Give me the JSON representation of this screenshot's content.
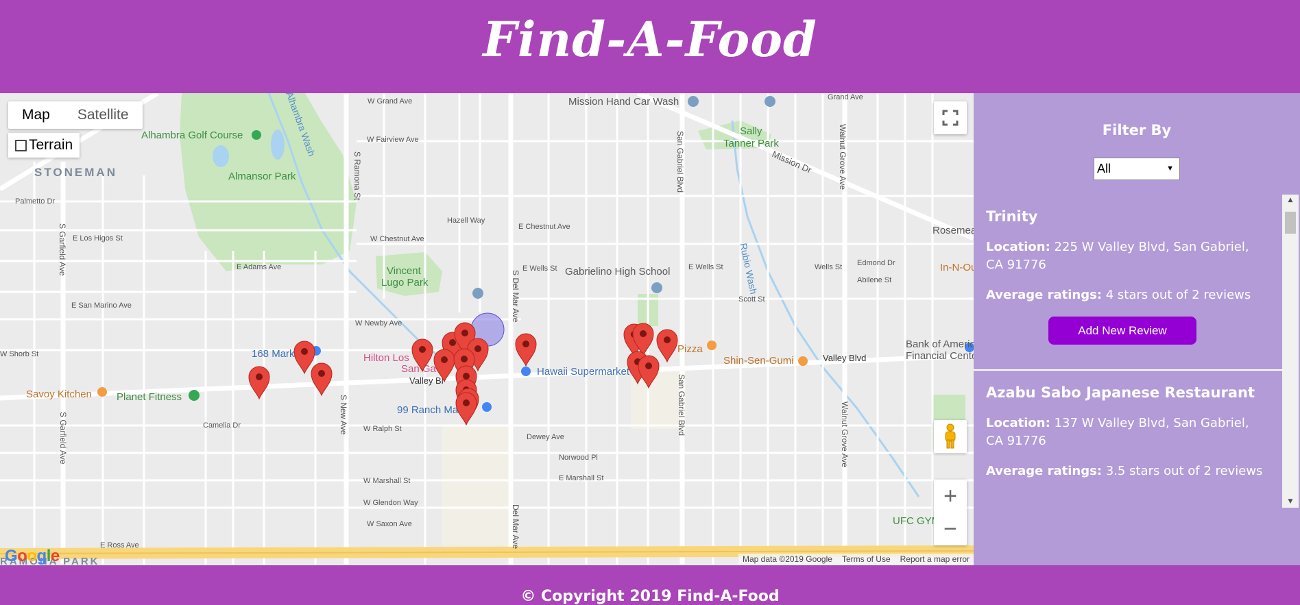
{
  "header": {
    "title": "Find-A-Food"
  },
  "map": {
    "controls": {
      "map_label": "Map",
      "satellite_label": "Satellite",
      "terrain_label": "Terrain",
      "zoom_in": "+",
      "zoom_out": "−"
    },
    "logo": "Google",
    "attribution": {
      "data": "Map data ©2019 Google",
      "terms": "Terms of Use",
      "report": "Report a map error"
    },
    "places": {
      "alhambra_golf": "Alhambra Golf Course",
      "stoneman": "STONEMAN",
      "almansor_park": "Almansor Park",
      "vincent_lugo": "Vincent",
      "vincent_lugo2": "Lugo Park",
      "gabrielino": "Gabrielino High School",
      "sally_tanner": "Sally",
      "sally_tanner2": "Tanner Park",
      "mission_hand": "Mission Hand Car Wash",
      "hawaii": "Hawaii Supermarket",
      "ranch99": "99 Ranch Ma",
      "planet_fitness": "Planet Fitness",
      "savoy": "Savoy Kitchen",
      "shin_sen": "Shin-Sen-Gumi",
      "boa": "Bank of America",
      "boa2": "Financial Center",
      "hilton": "Hilton Los",
      "san_ga": "San Ga",
      "pizza": "Pizza",
      "in_n_out": "In-N-Ou",
      "rosemead": "Rosemea",
      "ufc": "UFC GYM",
      "ramona_park": "RAMONA PARK",
      "market168": "168 Mark",
      "rubio_wash": "Rubio Wash",
      "alhambra_wash": "Alhambra Wash"
    },
    "streets": {
      "ramona": "S Ramona St",
      "delmar": "S Del Mar Ave",
      "delmar2": "Del Mar Ave",
      "sangabriel": "San Gabriel Blvd",
      "sangabriel2": "San Gabriel Blvd",
      "walnut_grove": "Walnut Grove Ave",
      "walnut_grove2": "Walnut Grove Ave",
      "garfield": "S Garfield Ave",
      "garfield2": "S Garfield Ave",
      "new_ave": "S New Ave",
      "valley": "Valley Blvd",
      "valley2": "Valley Bl",
      "mission": "Mission Dr",
      "grand": "W Grand Ave",
      "grand2": "Grand Ave",
      "fairview": "W Fairview Ave",
      "chestnut": "E Chestnut Ave",
      "chestnut_w": "W Chestnut Ave",
      "wells": "E Wells St",
      "wells2": "E Wells St",
      "wells3": "Wells St",
      "adams": "E Adams Ave",
      "newby": "W Newby Ave",
      "shorb": "W Shorb St",
      "camelia": "Camelia Dr",
      "ralph": "W Ralph St",
      "dewey": "Dewey Ave",
      "norwood": "Norwood Pl",
      "marshall": "E Marshall St",
      "marshall_w": "W Marshall St",
      "glendon": "W Glendon Way",
      "saxon": "W Saxon Ave",
      "ross": "E Ross Ave",
      "los_higos": "E Los Higos St",
      "san_marino": "E San Marino Ave",
      "palmetto": "Palmetto Dr",
      "hazell": "Hazell Way",
      "scott": "Scott St",
      "edmond": "Edmond Dr",
      "abilene": "Abilene St"
    }
  },
  "sidebar": {
    "filter_label": "Filter By",
    "filter_value": "All",
    "restaurants": [
      {
        "name": "Trinity",
        "location_label": "Location:",
        "location": " 225 W Valley Blvd, San Gabriel, CA 91776",
        "ratings_label": "Average ratings:",
        "ratings": " 4 stars out of 2 reviews",
        "button": "Add New Review"
      },
      {
        "name": "Azabu Sabo Japanese Restaurant",
        "location_label": "Location:",
        "location": " 137 W Valley Blvd, San Gabriel, CA 91776",
        "ratings_label": "Average ratings:",
        "ratings": " 3.5 stars out of 2 reviews"
      }
    ]
  },
  "footer": {
    "copyright": "© Copyright 2019 Find-A-Food"
  },
  "colors": {
    "brand": "#a944b9",
    "sidebar": "#b39bd7",
    "button": "#9400d3",
    "marker": "#e8453c"
  },
  "icons": [
    "fullscreen-icon",
    "pegman-icon",
    "marker-icon",
    "location-circle-icon",
    "checkbox-icon",
    "dropdown-arrow-icon"
  ]
}
